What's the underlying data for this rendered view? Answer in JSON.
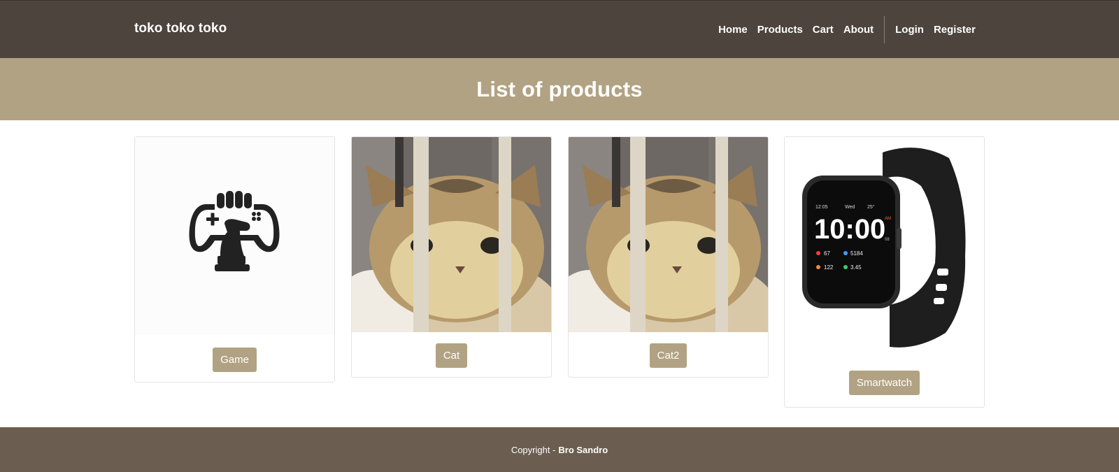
{
  "navbar": {
    "brand": "toko toko toko",
    "links": [
      "Home",
      "Products",
      "Cart",
      "About"
    ],
    "auth": [
      "Login",
      "Register"
    ]
  },
  "hero": {
    "title": "List of products"
  },
  "products": [
    {
      "name": "Game",
      "image": "game-controller-fist-logo"
    },
    {
      "name": "Cat",
      "image": "cat-behind-bars-photo"
    },
    {
      "name": "Cat2",
      "image": "cat-behind-bars-photo"
    },
    {
      "name": "Smartwatch",
      "image": "black-smartwatch-photo"
    }
  ],
  "watch_face": {
    "date": "12:05",
    "day": "Wed",
    "temp": "25°",
    "time": "10:00",
    "ampm": "AM",
    "seconds": "08",
    "heart": "67",
    "steps": "5184",
    "calories": "122",
    "distance": "3.45"
  },
  "footer": {
    "prefix": "Copyright -",
    "author": "Bro Sandro"
  },
  "colors": {
    "navbar": "#4c443d",
    "hero": "#b1a283",
    "button": "#b1a283",
    "footer": "#6b5e50"
  }
}
